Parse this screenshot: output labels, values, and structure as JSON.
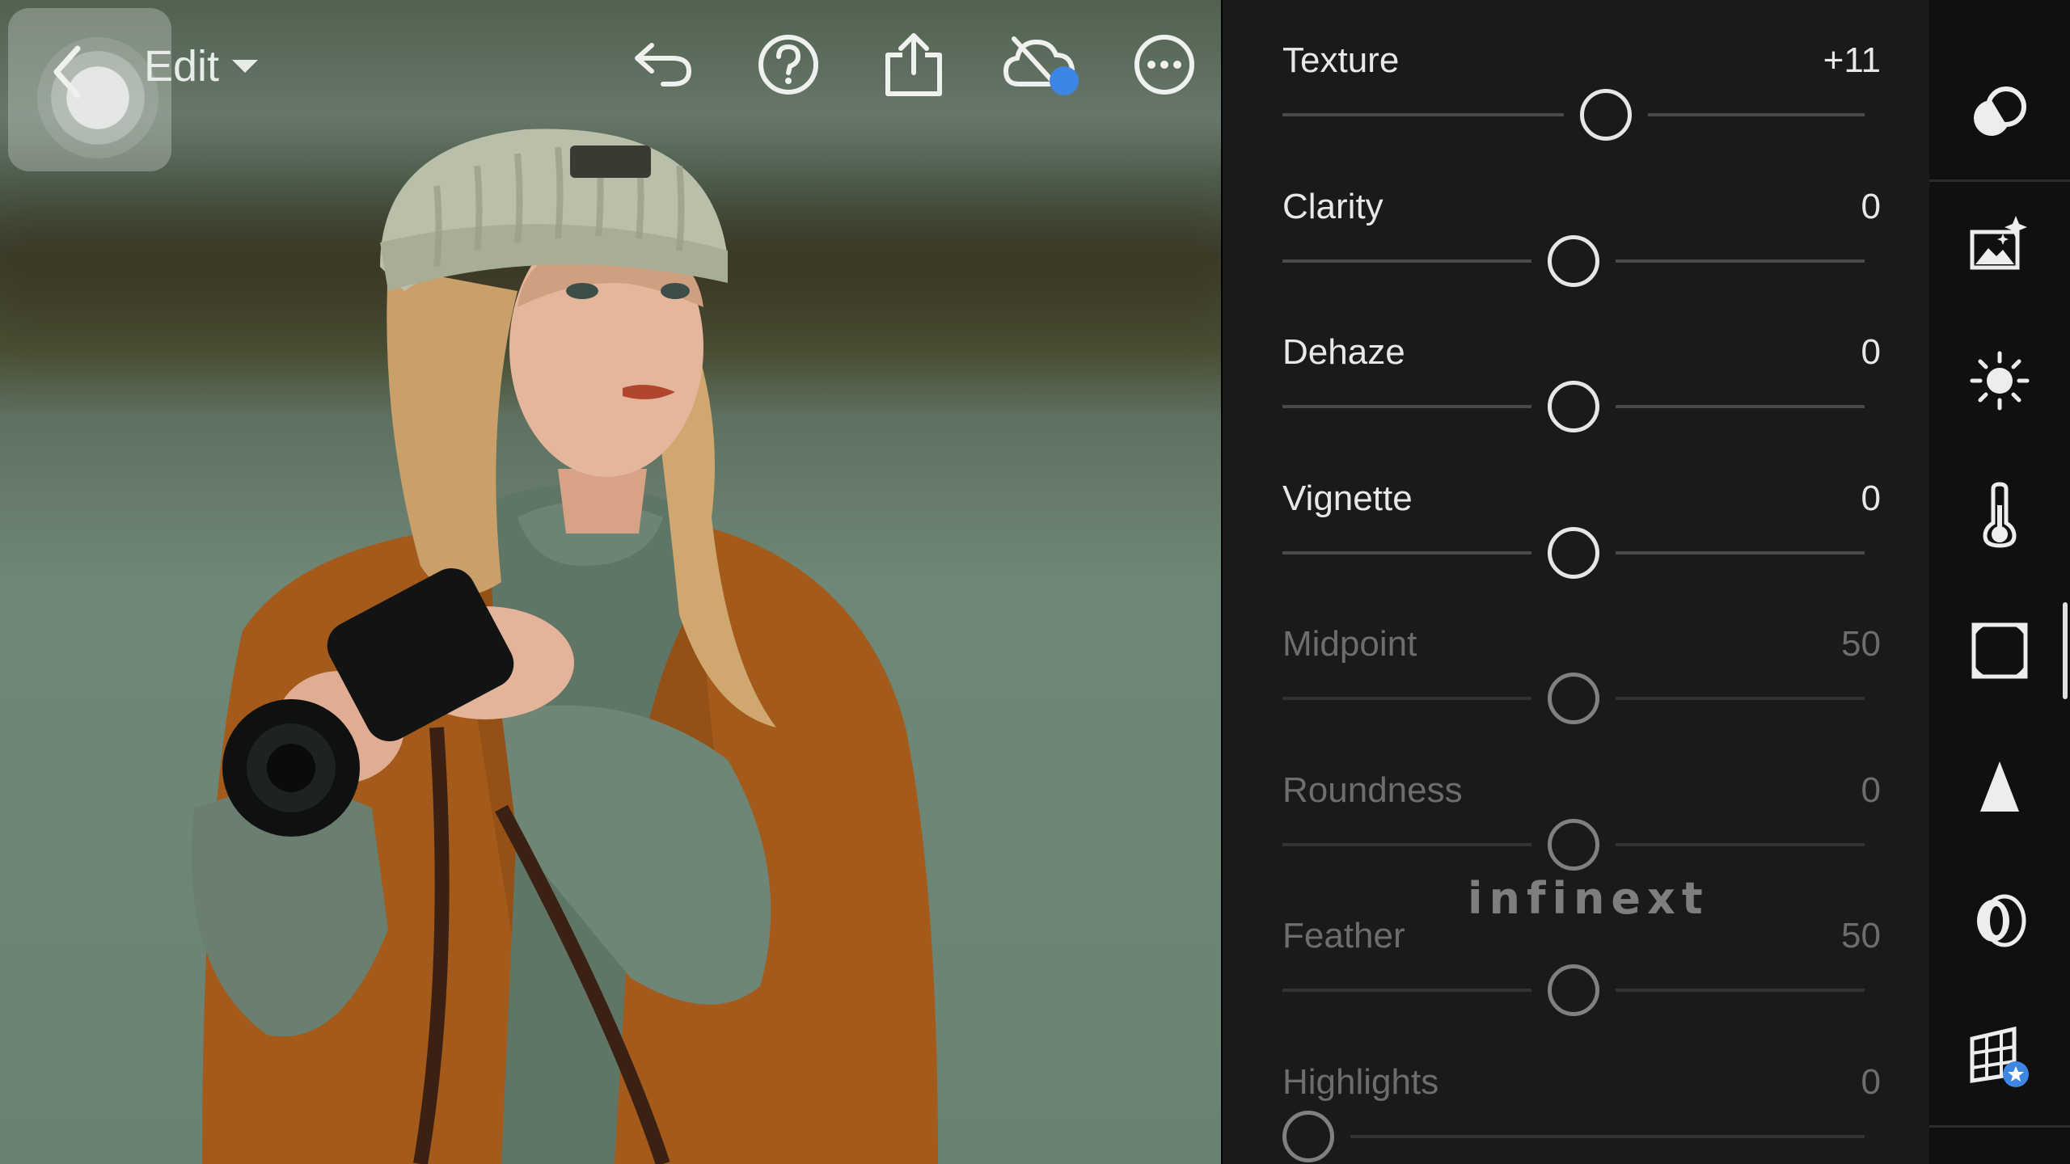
{
  "toolbar": {
    "edit_label": "Edit",
    "icons": [
      "back-icon",
      "chevron-down-icon",
      "undo-icon",
      "help-icon",
      "share-icon",
      "cloud-sync-icon",
      "more-icon"
    ]
  },
  "panel": {
    "adjustments": [
      {
        "label": "Texture",
        "value": "+11",
        "position": 0.555,
        "dimmed": false
      },
      {
        "label": "Clarity",
        "value": "0",
        "position": 0.5,
        "dimmed": false
      },
      {
        "label": "Dehaze",
        "value": "0",
        "position": 0.5,
        "dimmed": false
      },
      {
        "label": "Vignette",
        "value": "0",
        "position": 0.5,
        "dimmed": false
      },
      {
        "label": "Midpoint",
        "value": "50",
        "position": 0.5,
        "dimmed": true
      },
      {
        "label": "Roundness",
        "value": "0",
        "position": 0.5,
        "dimmed": true
      },
      {
        "label": "Feather",
        "value": "50",
        "position": 0.5,
        "dimmed": true
      },
      {
        "label": "Highlights",
        "value": "0",
        "position": 0.0,
        "dimmed": true
      }
    ],
    "watermark": "infinext"
  },
  "rail": {
    "tools": [
      "masking-icon",
      "auto-enhance-icon",
      "light-icon",
      "color-temperature-icon",
      "effects-icon",
      "detail-icon",
      "optics-icon",
      "geometry-icon"
    ],
    "active_tool": "effects-icon",
    "colors": {
      "accent": "#3d86e4",
      "panel_bg": "#1a1a1a",
      "rail_bg": "#101010"
    }
  }
}
